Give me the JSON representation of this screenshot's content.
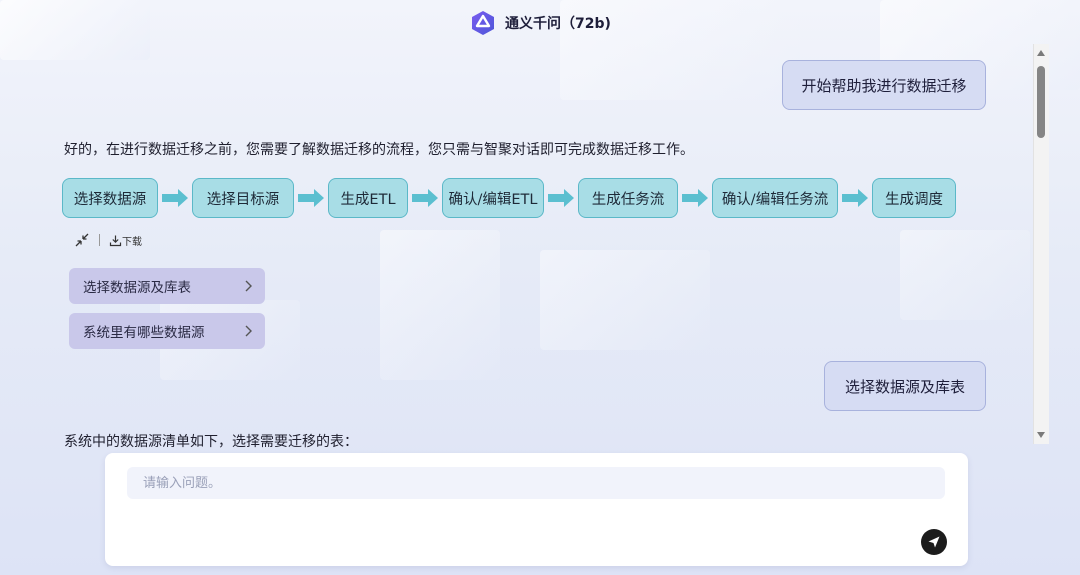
{
  "header": {
    "title": "通义千问（72b)",
    "logo_icon": "qwen-logo-icon"
  },
  "messages": {
    "user_1": "开始帮助我进行数据迁移",
    "answer_1": "好的，在进行数据迁移之前，您需要了解数据迁移的流程，您只需与智聚对话即可完成数据迁移工作。",
    "flow_steps": [
      "选择数据源",
      "选择目标源",
      "生成ETL",
      "确认/编辑ETL",
      "生成任务流",
      "确认/编辑任务流",
      "生成调度"
    ],
    "tools": {
      "collapse_icon": "collapse-icon",
      "download_label": "下载"
    },
    "suggestions": [
      "选择数据源及库表",
      "系统里有哪些数据源"
    ],
    "user_2": "选择数据源及库表",
    "answer_2": "系统中的数据源清单如下，选择需要迁移的表："
  },
  "input": {
    "placeholder": "请输入问题。",
    "send_icon": "send-icon"
  },
  "colors": {
    "step_fill": "#a8dde6",
    "step_border": "#5bb8c8",
    "arrow": "#5bbfd0",
    "user_bubble": "#d6dcf3",
    "suggestion": "#c9c8ea"
  }
}
